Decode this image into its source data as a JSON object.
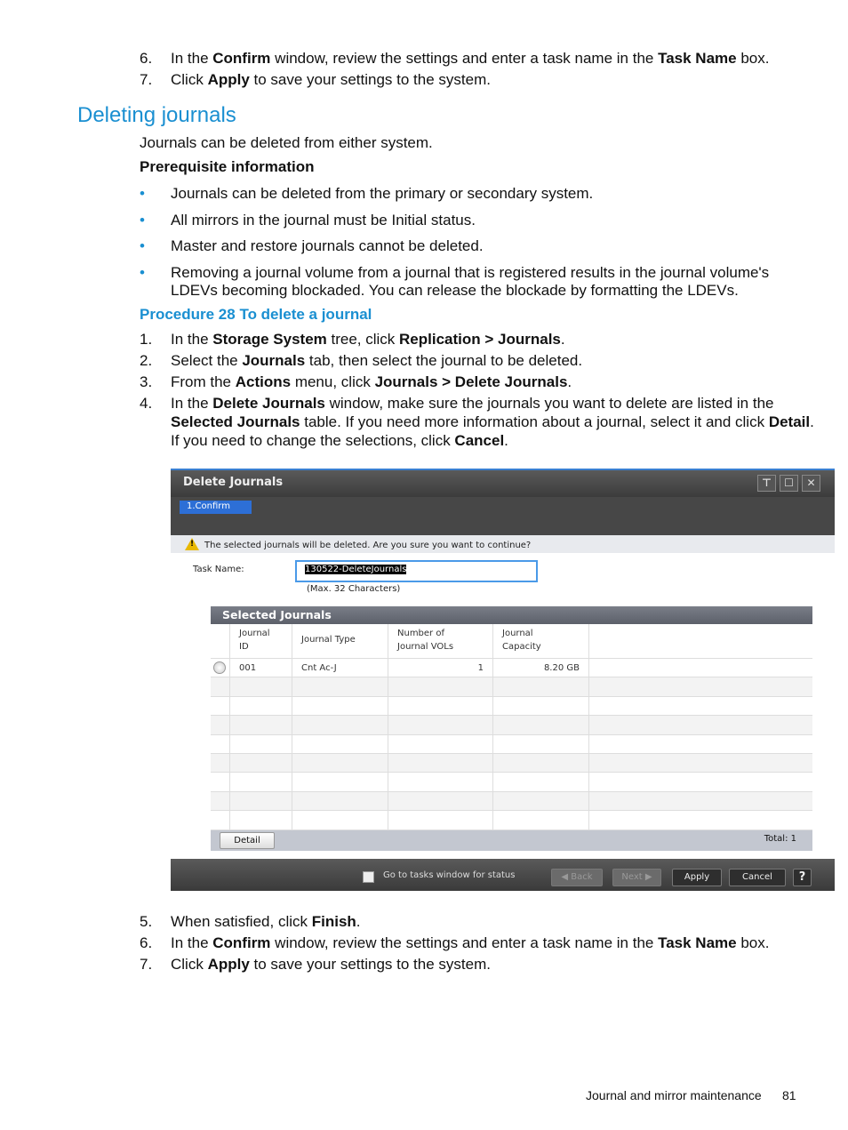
{
  "top_steps": [
    {
      "n": "6.",
      "segs": [
        {
          "t": "In the "
        },
        {
          "t": "Confirm",
          "b": 1
        },
        {
          "t": " window, review the settings and enter a task name in the "
        },
        {
          "t": "Task Name",
          "b": 1
        },
        {
          "t": " box."
        }
      ]
    },
    {
      "n": "7.",
      "segs": [
        {
          "t": "Click "
        },
        {
          "t": "Apply",
          "b": 1
        },
        {
          "t": " to save your settings to the system."
        }
      ]
    }
  ],
  "section_title": "Deleting journals",
  "intro": "Journals can be deleted from either system.",
  "prereq_title": "Prerequisite information",
  "bullets": [
    "Journals can be deleted from the primary or secondary system.",
    "All mirrors in the journal must be Initial status.",
    "Master and restore journals cannot be deleted.",
    "Removing a journal volume from a journal that is registered results in the journal volume's",
    "LDEVs becoming blockaded. You can release the blockade by formatting the LDEVs."
  ],
  "procedure_title": "Procedure 28 To delete a journal",
  "steps": [
    {
      "n": "1.",
      "segs": [
        {
          "t": "In the "
        },
        {
          "t": "Storage System",
          "b": 1
        },
        {
          "t": " tree, click "
        },
        {
          "t": "Replication > Journals",
          "b": 1
        },
        {
          "t": "."
        }
      ]
    },
    {
      "n": "2.",
      "segs": [
        {
          "t": "Select the "
        },
        {
          "t": "Journals",
          "b": 1
        },
        {
          "t": " tab, then select the journal to be deleted."
        }
      ]
    },
    {
      "n": "3.",
      "segs": [
        {
          "t": "From the "
        },
        {
          "t": "Actions",
          "b": 1
        },
        {
          "t": " menu, click "
        },
        {
          "t": "Journals > Delete Journals",
          "b": 1
        },
        {
          "t": "."
        }
      ]
    },
    {
      "n": "4.",
      "segs": [
        {
          "t": "In the "
        },
        {
          "t": "Delete Journals",
          "b": 1
        },
        {
          "t": " window, make sure the journals you want to delete are listed in the"
        }
      ]
    },
    {
      "n": "",
      "segs": [
        {
          "t": "Selected Journals",
          "b": 1
        },
        {
          "t": " table. If you need more information about a journal, select it and click "
        },
        {
          "t": "Detail",
          "b": 1
        },
        {
          "t": "."
        }
      ]
    },
    {
      "n": "",
      "segs": [
        {
          "t": "If you need to change the selections, click "
        },
        {
          "t": "Cancel",
          "b": 1
        },
        {
          "t": "."
        }
      ]
    }
  ],
  "dialog": {
    "title": "Delete Journals",
    "step_tab": "1.Confirm",
    "warning": "The selected journals will be deleted. Are you sure you want to continue?",
    "task_name_label": "Task Name:",
    "task_name_value": "130522-DeleteJournals",
    "task_name_hint": "(Max. 32 Characters)",
    "table_title": "Selected Journals",
    "columns": [
      "Journal\nID",
      "Journal Type",
      "Number of\nJournal VOLs",
      "Journal\nCapacity"
    ],
    "rows": [
      [
        "001",
        "Cnt Ac-J",
        "1",
        "8.20 GB"
      ]
    ],
    "detail_button": "Detail",
    "total": "Total:  1",
    "goto_tasks": "Go to tasks window for status",
    "back": "Back",
    "next": "Next",
    "apply": "Apply",
    "cancel": "Cancel",
    "help": "?"
  },
  "bottom_steps": [
    {
      "n": "5.",
      "segs": [
        {
          "t": "When satisfied, click "
        },
        {
          "t": "Finish",
          "b": 1
        },
        {
          "t": "."
        }
      ]
    },
    {
      "n": "6.",
      "segs": [
        {
          "t": "In the "
        },
        {
          "t": "Confirm",
          "b": 1
        },
        {
          "t": " window, review the settings and enter a task name in the "
        },
        {
          "t": "Task Name",
          "b": 1
        },
        {
          "t": " box."
        }
      ]
    },
    {
      "n": "7.",
      "segs": [
        {
          "t": "Click "
        },
        {
          "t": "Apply",
          "b": 1
        },
        {
          "t": " to save your settings to the system."
        }
      ]
    }
  ],
  "footer": {
    "section": "Journal and mirror maintenance",
    "page": "81"
  }
}
